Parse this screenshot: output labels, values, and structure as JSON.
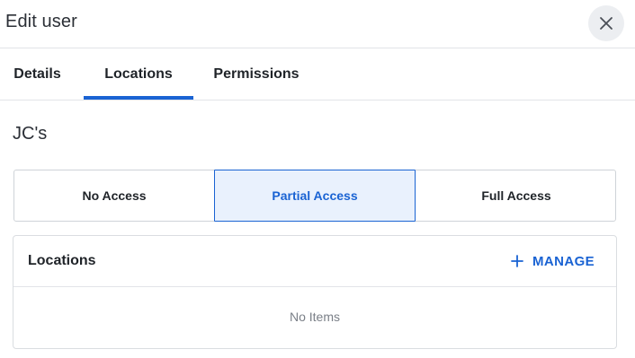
{
  "dialog": {
    "title": "Edit user",
    "close_icon": "close-icon"
  },
  "tabs": [
    {
      "label": "Details",
      "active": false
    },
    {
      "label": "Locations",
      "active": true
    },
    {
      "label": "Permissions",
      "active": false
    }
  ],
  "section": {
    "name": "JC's"
  },
  "access": {
    "options": [
      {
        "label": "No Access",
        "selected": false
      },
      {
        "label": "Partial Access",
        "selected": true
      },
      {
        "label": "Full Access",
        "selected": false
      }
    ]
  },
  "locations_card": {
    "title": "Locations",
    "manage_label": "MANAGE",
    "manage_icon": "plus-icon",
    "empty_text": "No Items"
  },
  "colors": {
    "accent": "#1a63d3",
    "selected_bg": "#e9f1fd",
    "border": "#dadde1",
    "muted_text": "#7a7f87"
  }
}
